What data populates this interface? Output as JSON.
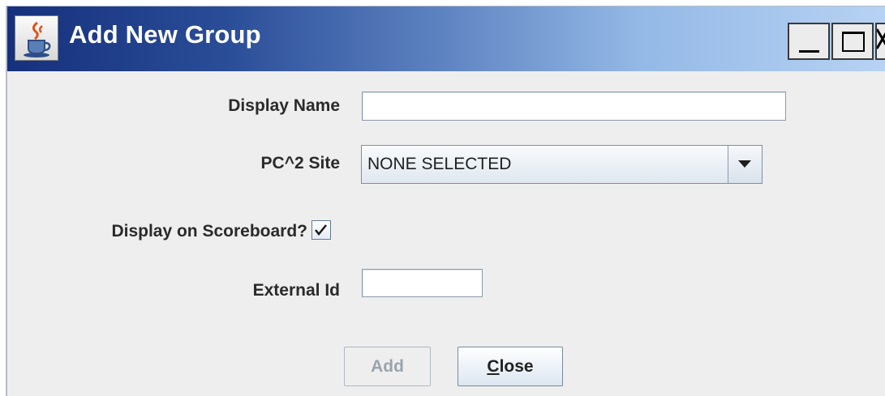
{
  "window": {
    "title": "Add New Group",
    "icon": "java-cup-icon"
  },
  "form": {
    "display_name_label": "Display Name",
    "display_name_value": "",
    "site_label": "PC^2 Site",
    "site_selected": "NONE SELECTED",
    "scoreboard_label": "Display on Scoreboard?",
    "scoreboard_checked": true,
    "external_id_label": "External Id",
    "external_id_value": ""
  },
  "buttons": {
    "add_label": "Add",
    "add_enabled": false,
    "close_label_mnemonic": "C",
    "close_label_rest": "lose"
  }
}
